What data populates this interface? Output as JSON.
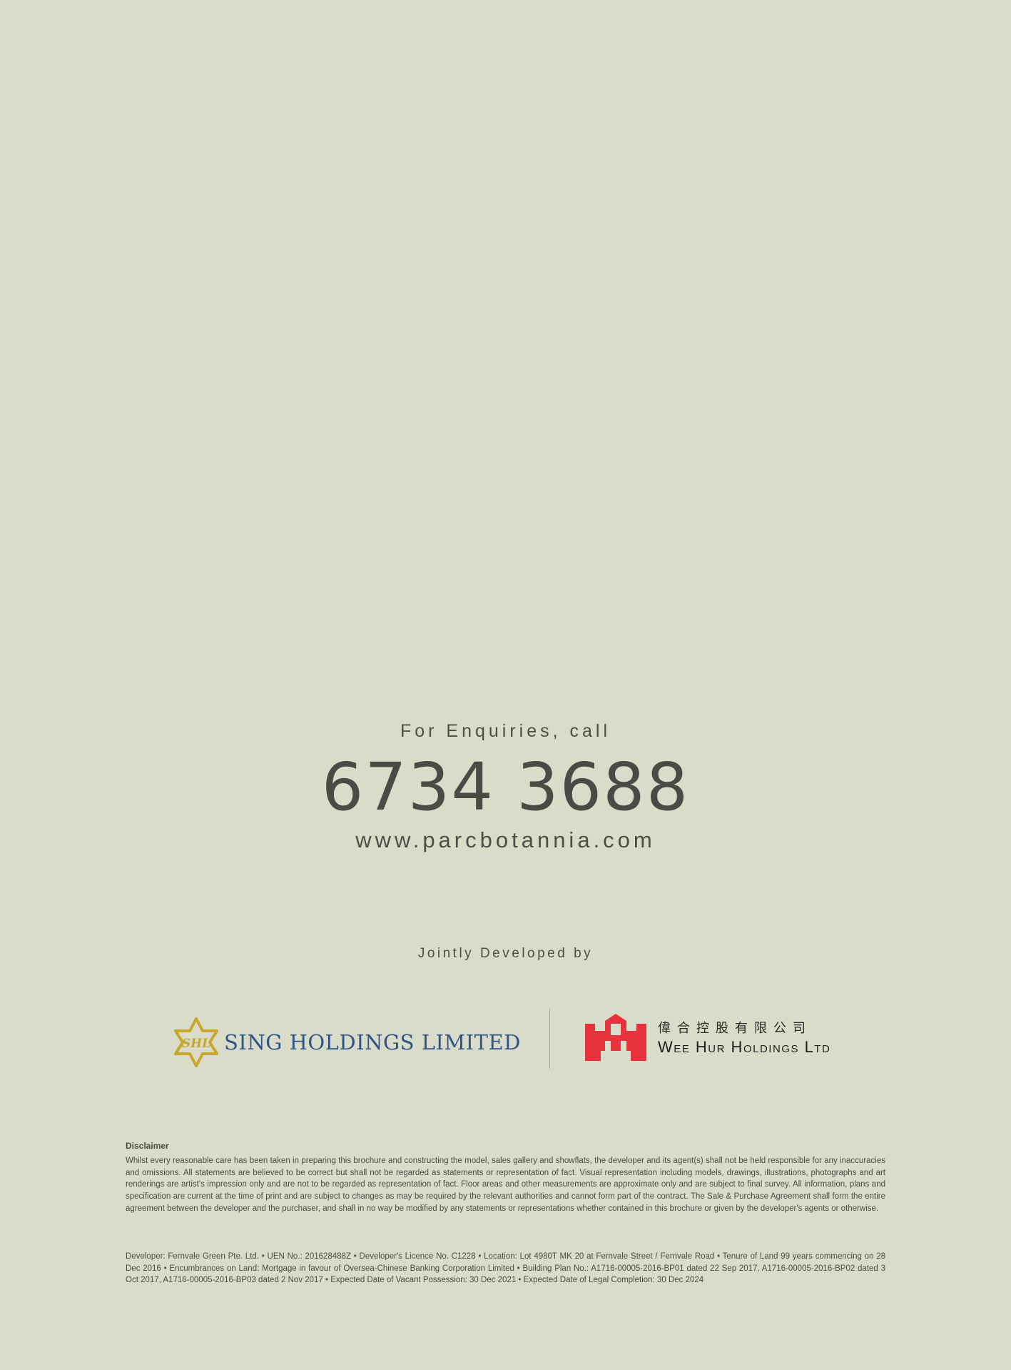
{
  "enquiry": {
    "label": "For Enquiries, call",
    "phone": "6734 3688",
    "website": "www.parcbotannia.com"
  },
  "developers": {
    "label": "Jointly Developed by",
    "sing_holdings": {
      "name": "SING HOLDINGS LIMITED",
      "emblem_letters": "SHL",
      "brand_color": "#2f5487",
      "emblem_color": "#c9a62c"
    },
    "wee_hur": {
      "name_cn": "偉合控股有限公司",
      "name_en": "Wee Hur Holdings Ltd",
      "brand_color": "#e8323c"
    }
  },
  "disclaimer": {
    "title": "Disclaimer",
    "text": "Whilst every reasonable care has been taken in preparing this brochure and constructing the model, sales gallery and showflats, the developer and its agent(s) shall not be held responsible for any inaccuracies and omissions. All statements are believed to be correct but shall not be regarded as statements or representation of fact. Visual representation including models, drawings, illustrations, photographs and art renderings are artist's impression only and are not to be regarded as representation of fact. Floor areas and other measurements are approximate only and are subject to final survey. All information, plans and specification are current at the time of print and are subject to changes as may be required by the relevant authorities and cannot form part of the contract. The Sale & Purchase Agreement shall form the entire agreement between the developer and the purchaser, and shall in no way be modified by any statements or representations whether contained in this brochure or given by the developer's agents or otherwise."
  },
  "developer_info": {
    "text": "Developer: Fernvale Green Pte. Ltd. • UEN No.: 201628488Z • Developer's Licence No. C1228 • Location: Lot 4980T MK 20 at Fernvale Street / Fernvale Road • Tenure of Land 99 years commencing on 28 Dec 2016 • Encumbrances on Land: Mortgage in favour of Oversea-Chinese Banking Corporation Limited • Building Plan No.: A1716-00005-2016-BP01 dated 22 Sep 2017, A1716-00005-2016-BP02 dated 3 Oct 2017, A1716-00005-2016-BP03 dated 2 Nov 2017 • Expected Date of Vacant Possession: 30 Dec 2021 • Expected Date of Legal Completion: 30 Dec 2024"
  }
}
